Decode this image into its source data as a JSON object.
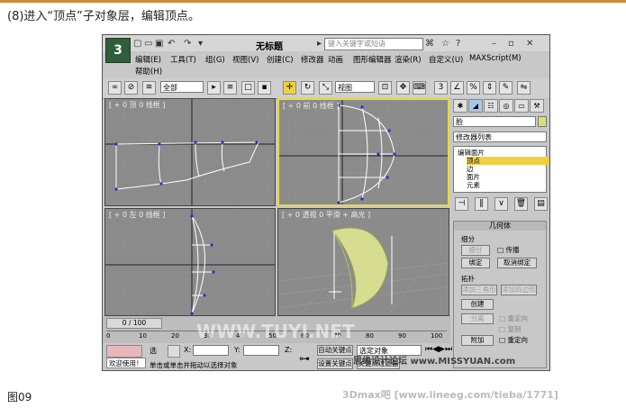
{
  "caption": "(8)进入“顶点”子对象层，编辑顶点。",
  "figure_label": "图09",
  "watermarks": {
    "site": "思缘设计论坛 www.MISSYUAN.com",
    "forum": "3Dmax吧  [www.lineeg.com/tieba/1771]",
    "tuyi": "WWW.TUYI.NET"
  },
  "app": {
    "logo": "3",
    "title": "无标题",
    "search_placeholder": "键入关键字或短语",
    "menu": [
      "编辑(E)",
      "工具(T)",
      "组(G)",
      "视图(V)",
      "创建(C)",
      "修改器",
      "动画",
      "图形编辑器",
      "渲染(R)",
      "自定义(U)",
      "MAXScript(M)",
      "帮助(H)"
    ]
  },
  "toolbar": {
    "selection_filter": "全部",
    "ref_coord": "视图"
  },
  "viewports": [
    {
      "label": "[ + 0 顶 0 线框 ]"
    },
    {
      "label": "[ + 0 前 0 线框 ]"
    },
    {
      "label": "[ + 0 左 0 线框 ]"
    },
    {
      "label": "[ + 0 透视 0 平滑 + 高光 ]"
    }
  ],
  "command_panel": {
    "object_name": "脸",
    "modifier_list": "修改器列表",
    "stack": [
      "编辑面片",
      "顶点",
      "边",
      "面片",
      "元素"
    ],
    "selected_stack": "顶点",
    "rollout_title": "几何体",
    "subdivide": {
      "title": "细分",
      "subdivide_btn": "细分",
      "propagate": "传播",
      "bind_btn": "绑定",
      "unbind_btn": "取消绑定"
    },
    "topology": {
      "title": "拓扑",
      "add_tri_btn": "添加三角形",
      "add_quad_btn": "添加四边形",
      "create_btn": "创建",
      "detach_btn": "分离",
      "reorient": "重定向",
      "copy": "复制",
      "attach_btn": "附加",
      "reorient2": "重定向"
    }
  },
  "timeline": {
    "frame": "0 / 100",
    "ticks": [
      "0",
      "10",
      "20",
      "30",
      "40",
      "50",
      "60",
      "70",
      "80",
      "90",
      "100"
    ]
  },
  "status": {
    "welcome": "欢迎使用！",
    "selected": "选",
    "x_label": "X:",
    "y_label": "Y:",
    "z_label": "Z:",
    "prompt": "单击或单击并拖动以选择对象",
    "autokey": "自动关键点",
    "selected_set": "选定对象",
    "set_key": "设置关键点",
    "key_filter": "关键点过滤器"
  },
  "colors": {
    "accent": "#e8d840",
    "viewport_bg": "#8b8b8b",
    "selected_row": "#f0d040",
    "panel_bg": "#c8c8c8"
  }
}
